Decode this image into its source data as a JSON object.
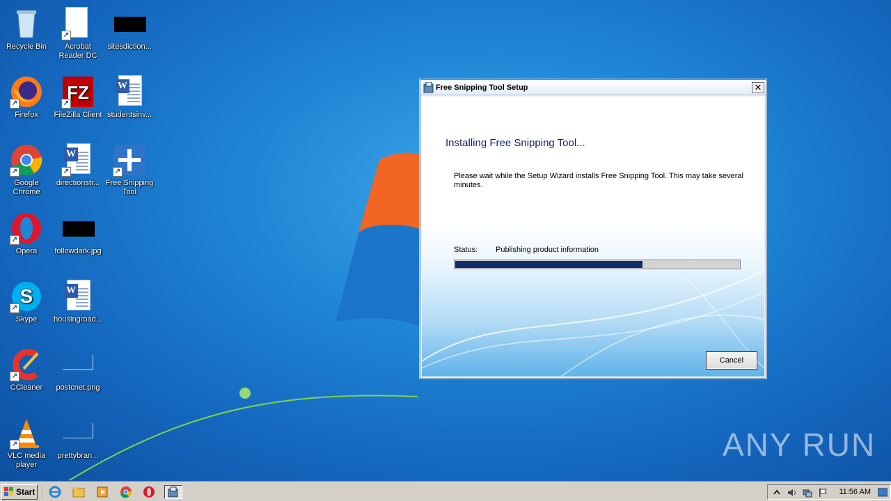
{
  "desktop": {
    "icons": [
      {
        "label": "Recycle Bin"
      },
      {
        "label": "Acrobat Reader DC"
      },
      {
        "label": "sitesdiction..."
      },
      {
        "label": "Firefox"
      },
      {
        "label": "FileZilla Client"
      },
      {
        "label": "studentsinv..."
      },
      {
        "label": "Google Chrome"
      },
      {
        "label": "directionstr..."
      },
      {
        "label": "Free Snipping Tool"
      },
      {
        "label": "Opera"
      },
      {
        "label": "followdark.jpg"
      },
      {
        "label": "Skype"
      },
      {
        "label": "housingroad..."
      },
      {
        "label": "CCleaner"
      },
      {
        "label": "postcnet.png"
      },
      {
        "label": "VLC media player"
      },
      {
        "label": "prettybran..."
      }
    ],
    "watermark": "ANY RUN"
  },
  "dialog": {
    "title": "Free Snipping Tool Setup",
    "close_glyph": "✕",
    "heading": "Installing Free Snipping Tool...",
    "description": "Please wait while the Setup Wizard installs Free Snipping Tool.  This may take several minutes.",
    "status_label": "Status:",
    "status_value": "Publishing product information",
    "progress_fraction": 0.66,
    "cancel_label": "Cancel"
  },
  "taskbar": {
    "start_label": "Start",
    "clock": "11:56 AM"
  },
  "colors": {
    "progress": "#0f2e6b",
    "heading": "#0f1f6e",
    "desktop": "#1f86d6"
  }
}
